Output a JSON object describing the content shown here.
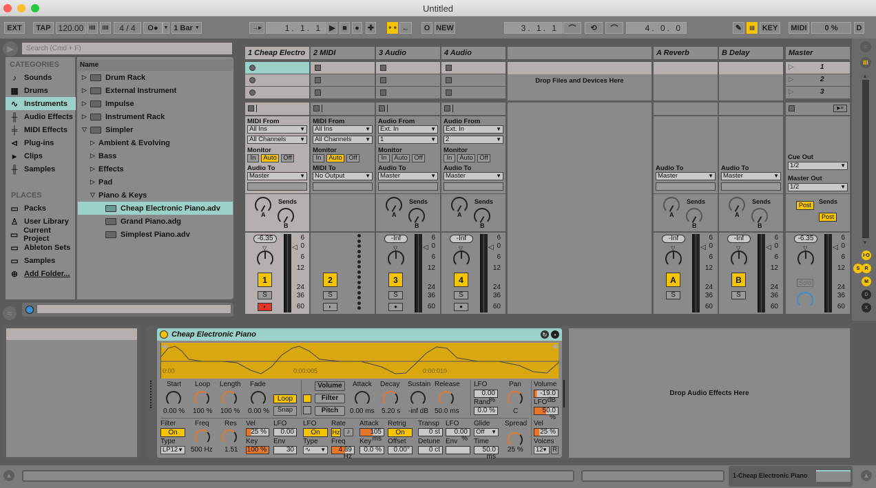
{
  "window": {
    "title": "Untitled"
  },
  "control_bar": {
    "ext": "EXT",
    "tap": "TAP",
    "tempo": "120.00",
    "nudge_down": "IIII",
    "nudge_up": "IIII",
    "signature": "4  /  4",
    "metronome": "O●",
    "quantize": "1 Bar",
    "follow": "→▸",
    "arrangement_position": "1.  1.  1",
    "play": "▶",
    "stop": "■",
    "record": "●",
    "add": "✚",
    "automation_arm": "⚬⚬",
    "back_to_arrangement": "←",
    "session_record": "O",
    "new": "NEW",
    "loop_start": "3.  1.  1",
    "punch_in": "⌒",
    "loop": "⟲",
    "punch_out": "⌒",
    "loop_length": "4.  0.  0",
    "draw_mode": "✎",
    "key_map_icon": "III",
    "key": "KEY",
    "midi": "MIDI",
    "cpu": "0 %",
    "disk": "D"
  },
  "browser": {
    "search_placeholder": "Search (Cmd + F)",
    "categories_header": "CATEGORIES",
    "categories": [
      {
        "icon": "♪",
        "label": "Sounds"
      },
      {
        "icon": "▦",
        "label": "Drums"
      },
      {
        "icon": "∿",
        "label": "Instruments",
        "selected": true
      },
      {
        "icon": "╫",
        "label": "Audio Effects"
      },
      {
        "icon": "╪",
        "label": "MIDI Effects"
      },
      {
        "icon": "⊲",
        "label": "Plug-ins"
      },
      {
        "icon": "▸",
        "label": "Clips"
      },
      {
        "icon": "╫",
        "label": "Samples"
      }
    ],
    "places_header": "PLACES",
    "places": [
      {
        "icon": "▭",
        "label": "Packs"
      },
      {
        "icon": "♙",
        "label": "User Library"
      },
      {
        "icon": "▭",
        "label": "Current Project"
      },
      {
        "icon": "▭",
        "label": "Ableton Sets"
      },
      {
        "icon": "▭",
        "label": "Samples"
      },
      {
        "icon": "⊕",
        "label": "Add Folder..."
      }
    ],
    "column_header": "Name",
    "items": [
      {
        "label": "Drum Rack",
        "expander": "▷",
        "folder": true
      },
      {
        "label": "External Instrument",
        "expander": "▷",
        "folder": true
      },
      {
        "label": "Impulse",
        "expander": "▷",
        "folder": true
      },
      {
        "label": "Instrument Rack",
        "expander": "▷",
        "folder": true
      },
      {
        "label": "Simpler",
        "expander": "▽",
        "folder": true
      },
      {
        "label": "Ambient & Evolving",
        "expander": "▷"
      },
      {
        "label": "Bass",
        "expander": "▷"
      },
      {
        "label": "Effects",
        "expander": "▷"
      },
      {
        "label": "Pad",
        "expander": "▷"
      },
      {
        "label": "Piano & Keys",
        "expander": "▽"
      },
      {
        "label": "Cheap Electronic Piano.adv",
        "selected": true
      },
      {
        "label": "Grand Piano.adg"
      },
      {
        "label": "Simplest Piano.adv"
      }
    ]
  },
  "session": {
    "drop_text": "Drop Files and Devices Here",
    "tracks": [
      {
        "name": "1 Cheap Electro",
        "in_label": "MIDI From",
        "in_val": "All Ins",
        "ch_val": "All Channels",
        "out_label": "Audio To",
        "out_val": "Master",
        "volume": "-6.35",
        "number": "1",
        "solo": "S",
        "monitor": "Auto"
      },
      {
        "name": "2 MIDI",
        "in_label": "MIDI From",
        "in_val": "All Ins",
        "ch_val": "All Channels",
        "out_label": "MIDI To",
        "out_val": "No Output",
        "number": "2",
        "solo": "S",
        "monitor": "Auto"
      },
      {
        "name": "3 Audio",
        "in_label": "Audio From",
        "in_val": "Ext. In",
        "ch_val": "1",
        "out_label": "Audio To",
        "out_val": "Master",
        "volume": "-Inf",
        "number": "3",
        "solo": "S",
        "monitor": "Off"
      },
      {
        "name": "4 Audio",
        "in_label": "Audio From",
        "in_val": "Ext. In",
        "ch_val": "2",
        "out_label": "Audio To",
        "out_val": "Master",
        "volume": "-Inf",
        "number": "4",
        "solo": "S",
        "monitor": "Off"
      }
    ],
    "returns": [
      {
        "name": "A Reverb",
        "out_label": "Audio To",
        "out_val": "Master",
        "volume": "-Inf",
        "letter": "A",
        "solo": "S"
      },
      {
        "name": "B Delay",
        "out_label": "Audio To",
        "out_val": "Master",
        "volume": "-Inf",
        "letter": "B",
        "solo": "S"
      }
    ],
    "master": {
      "name": "Master",
      "scenes": [
        "1",
        "2",
        "3"
      ],
      "cue_label": "Cue Out",
      "cue_val": "1/2",
      "out_label": "Master Out",
      "out_val": "1/2",
      "volume": "-6.35",
      "solo": "Solo",
      "post1": "Post",
      "post2": "Post"
    },
    "monitor_labels": {
      "label": "Monitor",
      "in": "In",
      "auto": "Auto",
      "off": "Off"
    },
    "sends_label": "Sends",
    "send_a": "A",
    "send_b": "B",
    "meter_scale": [
      "6",
      "0",
      "6",
      "12",
      "24",
      "36",
      "60"
    ],
    "view_toggles": [
      "I·O",
      "S",
      "R",
      "M",
      "D",
      "X"
    ]
  },
  "device": {
    "title": "Cheap Electronic Piano",
    "time_marks": [
      "0:00",
      "0:00:005",
      "0:00:010"
    ],
    "sample": {
      "start": {
        "label": "Start",
        "value": "0.00 %"
      },
      "loop": {
        "label": "Loop",
        "value": "100 %"
      },
      "length": {
        "label": "Length",
        "value": "100 %"
      },
      "fade": {
        "label": "Fade",
        "value": "0.00 %"
      },
      "loop_btn": "Loop",
      "snap_btn": "Snap"
    },
    "env_tabs": [
      "Volume",
      "Filter",
      "Pitch"
    ],
    "env": {
      "attack": {
        "label": "Attack",
        "value": "0.00 ms"
      },
      "decay": {
        "label": "Decay",
        "value": "5.20 s"
      },
      "sustain": {
        "label": "Sustain",
        "value": "-inf dB"
      },
      "release": {
        "label": "Release",
        "value": "50.0 ms"
      }
    },
    "lfo_amt": {
      "label": "LFO",
      "value": "0.00 %",
      "rand_label": "Rand",
      "rand_value": "0.0 %"
    },
    "pan": {
      "label": "Pan",
      "value": "C"
    },
    "volume": {
      "label": "Volume",
      "value": "-19.0 dB",
      "lfo_label": "LFO",
      "lfo_value": "50.0 %"
    },
    "filter": {
      "label": "Filter",
      "on": "On",
      "type_label": "Type",
      "type": "LP12",
      "freq_label": "Freq",
      "freq": "500 Hz",
      "res_label": "Res",
      "res": "1.51",
      "vel_label": "Vel",
      "vel": "25 %",
      "key_label": "Key",
      "key": "100 %",
      "lfo_label": "LFO",
      "lfo": "0.00",
      "env_label": "Env",
      "env": "30"
    },
    "lfo": {
      "label": "LFO",
      "on": "On",
      "type_label": "Type",
      "type": "∿",
      "rate_label": "Rate",
      "hz": "Hz",
      "note": "♪",
      "freq_label": "Freq",
      "freq": "4.89 Hz",
      "attack_label": "Attack",
      "attack": "105 ms",
      "retrig_label": "Retrig",
      "retrig": "On",
      "key_label": "Key",
      "key": "0.0 %",
      "offset_label": "Offset",
      "offset": "0.00°"
    },
    "pitch": {
      "transp_label": "Transp",
      "transp": "0 st",
      "lfo_label": "LFO",
      "lfo": "0.00 %",
      "detune_label": "Detune",
      "detune": "0 ct",
      "env_label": "Env",
      "glide_label": "Glide",
      "glide": "Off",
      "time_label": "Time",
      "time": "50.0 ms",
      "spread_label": "Spread",
      "spread": "25 %"
    },
    "global": {
      "vel_label": "Vel",
      "vel": "25 %",
      "voices_label": "Voices",
      "voices": "12",
      "retrig": "R"
    },
    "drop_fx": "Drop Audio Effects Here"
  },
  "status_bar": {
    "selected_track": "1-Cheap Electronic Piano"
  }
}
